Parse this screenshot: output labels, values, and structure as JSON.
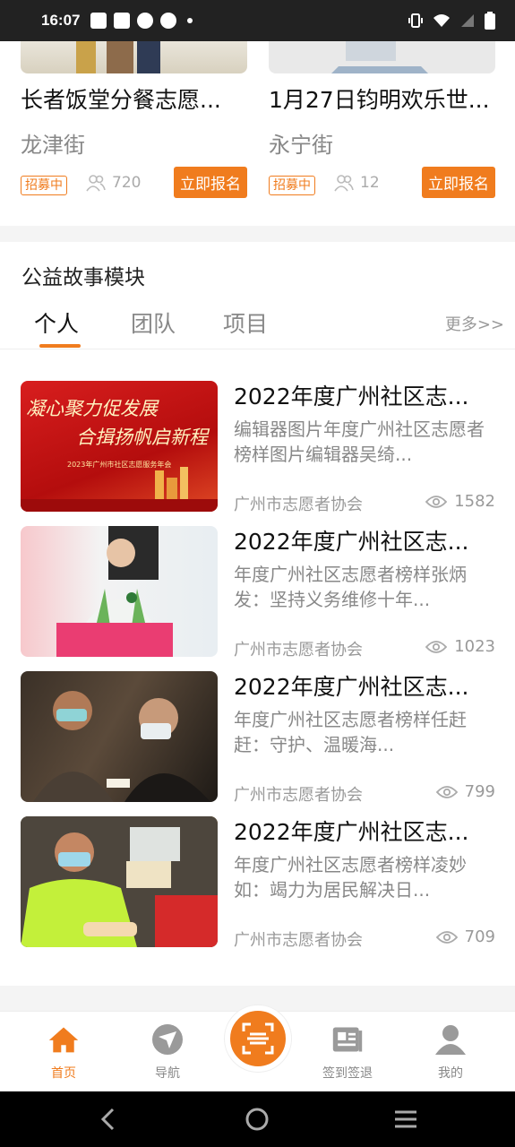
{
  "status_bar": {
    "time": "16:07"
  },
  "activities": [
    {
      "title": "长者饭堂分餐志愿...",
      "street": "龙津街",
      "tag": "招募中",
      "count": "720",
      "button": "立即报名"
    },
    {
      "title": "1月27日钧明欢乐世...",
      "street": "永宁街",
      "tag": "招募中",
      "count": "12",
      "button": "立即报名"
    }
  ],
  "stories": {
    "title": "公益故事模块",
    "tabs": [
      "个人",
      "团队",
      "项目"
    ],
    "more": "更多>>",
    "items": [
      {
        "title": "2022年度广州社区志...",
        "summary": "编辑器图片年度广州社区志愿者榜样图片编辑器吴绮...",
        "org": "广州市志愿者协会",
        "views": "1582",
        "thumb_text_1": "凝心聚力促发展",
        "thumb_text_2": "合揖扬帆启新程",
        "thumb_text_3": "2023年广州市社区志愿服务年会"
      },
      {
        "title": "2022年度广州社区志...",
        "summary": "年度广州社区志愿者榜样张炳发：坚持义务维修十年...",
        "org": "广州市志愿者协会",
        "views": "1023"
      },
      {
        "title": "2022年度广州社区志...",
        "summary": "年度广州社区志愿者榜样任赶赶：守护、温暖海...",
        "org": "广州市志愿者协会",
        "views": "799"
      },
      {
        "title": "2022年度广州社区志...",
        "summary": "年度广州社区志愿者榜样凌妙如：竭力为居民解决日...",
        "org": "广州市志愿者协会",
        "views": "709"
      }
    ]
  },
  "bottom_nav": [
    {
      "label": "首页",
      "icon": "home-icon"
    },
    {
      "label": "导航",
      "icon": "navigation-icon"
    },
    {
      "label": "",
      "icon": "scan-icon"
    },
    {
      "label": "签到签退",
      "icon": "checkin-icon"
    },
    {
      "label": "我的",
      "icon": "profile-icon"
    }
  ],
  "colors": {
    "accent": "#f07c1e"
  }
}
